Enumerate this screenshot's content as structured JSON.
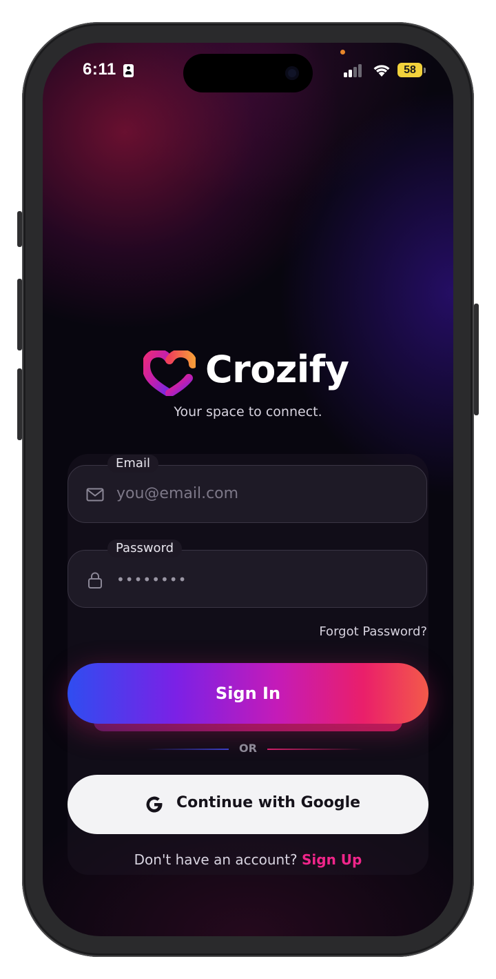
{
  "status_bar": {
    "time": "6:11",
    "battery": "58",
    "icons": [
      "contact-card-icon",
      "signal-icon",
      "wifi-icon",
      "battery-icon"
    ]
  },
  "brand": {
    "name": "Crozify",
    "tagline": "Your space to connect.",
    "logo_icon": "heart-c-logo-icon"
  },
  "form": {
    "email": {
      "label": "Email",
      "placeholder": "you@email.com",
      "icon": "mail-icon"
    },
    "password": {
      "label": "Password",
      "value": "••••••••",
      "icon": "lock-icon"
    },
    "forgot_label": "Forgot Password?",
    "signin_label": "Sign In",
    "or_label": "OR",
    "google_label": "Continue with Google",
    "google_icon": "google-icon",
    "signup_prompt": "Don't have an account?",
    "signup_link": "Sign Up"
  },
  "colors": {
    "accent_pink": "#f0258a",
    "gradient_start": "#2f4df0",
    "gradient_end": "#f35a4a",
    "background": "#08060f"
  }
}
